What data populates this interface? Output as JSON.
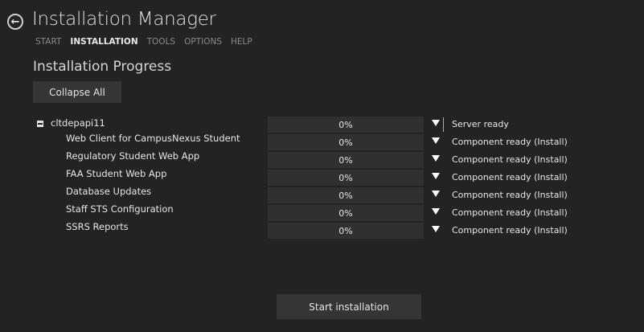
{
  "header": {
    "title": "Installation Manager",
    "nav": [
      "START",
      "INSTALLATION",
      "TOOLS",
      "OPTIONS",
      "HELP"
    ],
    "active_nav": "INSTALLATION"
  },
  "section_title": "Installation Progress",
  "collapse_label": "Collapse All",
  "server": {
    "name": "cltdepapi11",
    "progress": "0%",
    "status": "Server ready"
  },
  "components": [
    {
      "name": "Web Client for CampusNexus Student",
      "progress": "0%",
      "status": "Component ready (Install)"
    },
    {
      "name": "Regulatory Student Web App",
      "progress": "0%",
      "status": "Component ready (Install)"
    },
    {
      "name": "FAA Student Web App",
      "progress": "0%",
      "status": "Component ready (Install)"
    },
    {
      "name": "Database Updates",
      "progress": "0%",
      "status": "Component ready (Install)"
    },
    {
      "name": "Staff STS Configuration",
      "progress": "0%",
      "status": "Component ready (Install)"
    },
    {
      "name": "SSRS Reports",
      "progress": "0%",
      "status": "Component ready (Install)"
    }
  ],
  "start_label": "Start installation"
}
